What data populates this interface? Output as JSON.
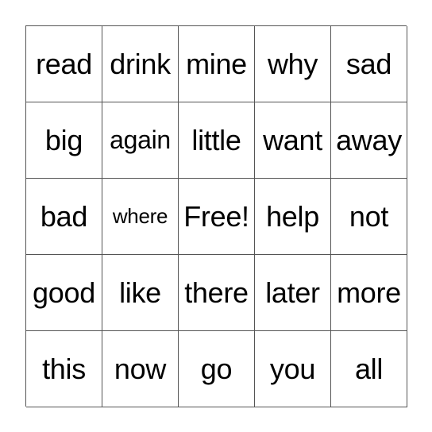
{
  "board": {
    "cells": [
      "read",
      "drink",
      "mine",
      "why",
      "sad",
      "big",
      "again",
      "little",
      "want",
      "away",
      "bad",
      "where",
      "Free!",
      "help",
      "not",
      "good",
      "like",
      "there",
      "later",
      "more",
      "this",
      "now",
      "go",
      "you",
      "all"
    ]
  }
}
